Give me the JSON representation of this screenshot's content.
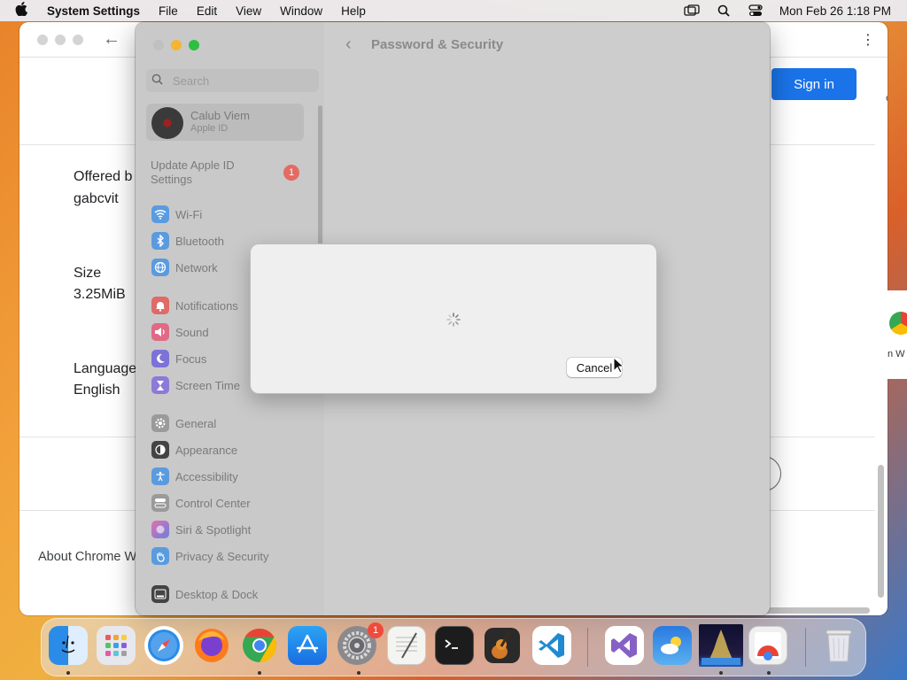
{
  "menubar": {
    "app_name": "System Settings",
    "menus": [
      "File",
      "Edit",
      "View",
      "Window",
      "Help"
    ],
    "clock": "Mon Feb 26  1:18 PM"
  },
  "chrome_window": {
    "sign_in_label": "Sign in",
    "offered_by_label": "Offered b",
    "offered_by_value": "gabcvit",
    "size_label": "Size",
    "size_value": "3.25MiB",
    "language_label": "Language",
    "language_value": "English",
    "footer_link": "About Chrome We",
    "right_partial_label": "n W"
  },
  "settings": {
    "search_placeholder": "Search",
    "profile": {
      "name": "Calub Viem",
      "subtitle": "Apple ID"
    },
    "update_label": "Update Apple ID Settings",
    "update_badge": "1",
    "items": [
      {
        "label": "Wi-Fi",
        "color": "#5a9be0",
        "icon": "wifi-icon"
      },
      {
        "label": "Bluetooth",
        "color": "#5a9be0",
        "icon": "bluetooth-icon"
      },
      {
        "label": "Network",
        "color": "#5a9be0",
        "icon": "globe-icon"
      },
      {
        "label": "Notifications",
        "color": "#e06a66",
        "icon": "bell-icon"
      },
      {
        "label": "Sound",
        "color": "#e06a86",
        "icon": "speaker-icon"
      },
      {
        "label": "Focus",
        "color": "#7c72d8",
        "icon": "moon-icon"
      },
      {
        "label": "Screen Time",
        "color": "#8d7ad8",
        "icon": "hourglass-icon"
      },
      {
        "label": "General",
        "color": "#9a9a9a",
        "icon": "gear-icon"
      },
      {
        "label": "Appearance",
        "color": "#444444",
        "icon": "appearance-icon"
      },
      {
        "label": "Accessibility",
        "color": "#5a9be0",
        "icon": "accessibility-icon"
      },
      {
        "label": "Control Center",
        "color": "#9a9a9a",
        "icon": "control-center-icon"
      },
      {
        "label": "Siri & Spotlight",
        "color": "#c06ad0",
        "icon": "siri-icon"
      },
      {
        "label": "Privacy & Security",
        "color": "#5a9be0",
        "icon": "hand-icon"
      },
      {
        "label": "Desktop & Dock",
        "color": "#444444",
        "icon": "dock-icon"
      }
    ],
    "page_title": "Password & Security"
  },
  "dialog": {
    "cancel_label": "Cancel"
  },
  "dock": {
    "settings_badge": "1",
    "apps": [
      "Finder",
      "Launchpad",
      "Safari",
      "Firefox",
      "Chrome",
      "App Store",
      "System Settings",
      "TextEdit",
      "Terminal",
      "GarageBand",
      "VS Code",
      "Visual Studio",
      "Weather",
      "Preview",
      "Chrome App",
      "Trash"
    ]
  }
}
